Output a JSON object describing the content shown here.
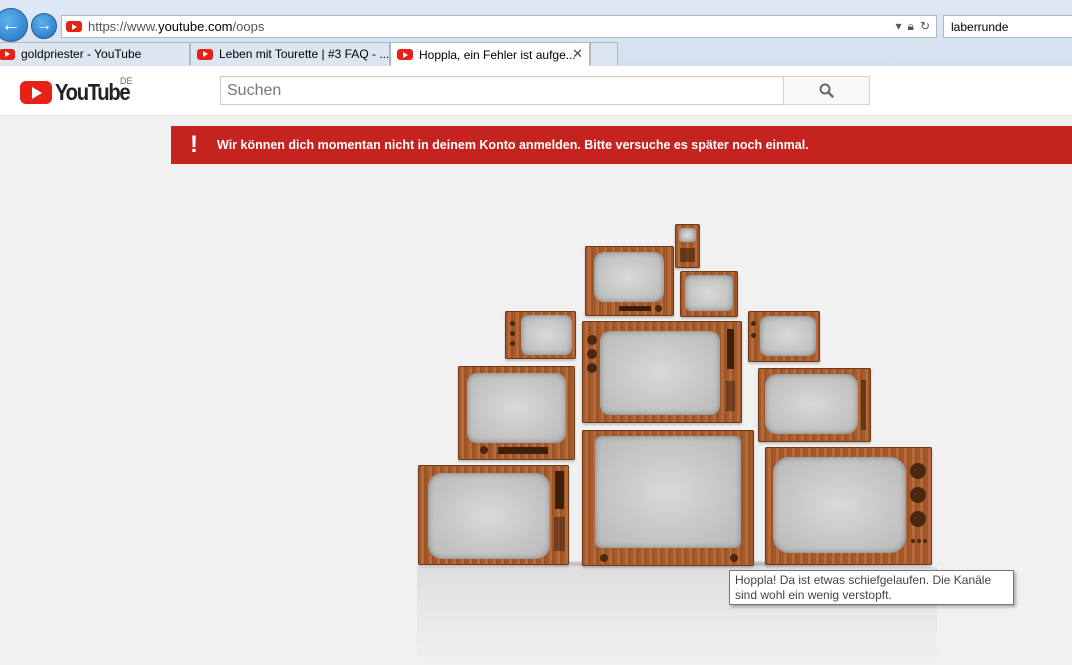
{
  "browser": {
    "url_prefix": "https://www.",
    "url_domain": "youtube.com",
    "url_path": "/oops",
    "search_value": "laberrunde",
    "tabs": [
      {
        "label": "goldpriester - YouTube"
      },
      {
        "label": "Leben mit Tourette | #3 FAQ - ..."
      },
      {
        "label": "Hoppla, ein Fehler ist aufge..."
      }
    ]
  },
  "header": {
    "logo_text": "YouTube",
    "country": "DE",
    "search_placeholder": "Suchen"
  },
  "alert": {
    "icon": "!",
    "message": "Wir können dich momentan nicht in deinem Konto anmelden. Bitte versuche es später noch einmal."
  },
  "tooltip": {
    "text": "Hoppla! Da ist etwas schiefgelaufen. Die Kanäle sind wohl ein wenig verstopft."
  },
  "colors": {
    "alert": "#c4231f",
    "brand": "#e62117"
  }
}
